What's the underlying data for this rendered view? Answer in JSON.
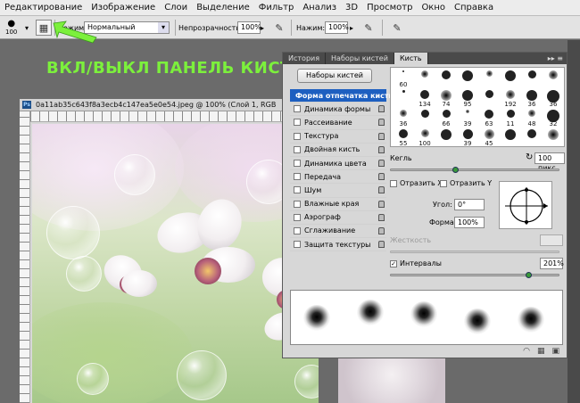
{
  "menu": [
    "Редактирование",
    "Изображение",
    "Слои",
    "Выделение",
    "Фильтр",
    "Анализ",
    "3D",
    "Просмотр",
    "Окно",
    "Справка"
  ],
  "options": {
    "brush_size": "100",
    "mode_label": "Режим:",
    "mode_value": "Нормальный",
    "opacity_label": "Непрозрачность:",
    "opacity_value": "100%",
    "flow_label": "Нажим:",
    "flow_value": "100%"
  },
  "annotation": "ВКЛ/ВЫКЛ ПАНЕЛЬ КИСТИ",
  "document": {
    "title": "0a11ab35c643f8a3ecb4c147ea5e0e54.jpeg @ 100% (Слой 1, RGB"
  },
  "panel": {
    "tabs": [
      "История",
      "Наборы кистей",
      "Кисть"
    ],
    "presets_button": "Наборы кистей",
    "options": [
      "Форма отпечатка кисти",
      "Динамика формы",
      "Рассеивание",
      "Текстура",
      "Двойная кисть",
      "Динамика цвета",
      "Передача",
      "Шум",
      "Влажные края",
      "Аэрограф",
      "Сглаживание",
      "Защита текстуры"
    ],
    "brush_tips": [
      "60",
      "",
      "",
      "",
      "",
      "",
      "",
      "",
      "",
      "134",
      "74",
      "95",
      "",
      "192",
      "36",
      "36",
      "36",
      "",
      "66",
      "39",
      "63",
      "11",
      "48",
      "32",
      "55",
      "100",
      "",
      "39",
      "45",
      "",
      "",
      "",
      "",
      "",
      "",
      ""
    ],
    "size_label": "Кегль",
    "size_value": "100 пикс",
    "flip_x": "Отразить X",
    "flip_y": "Отразить Y",
    "angle_label": "Угол:",
    "angle_value": "0°",
    "roundness_label": "Форма:",
    "roundness_value": "100%",
    "hardness_label": "Жесткость",
    "spacing_label": "Интервалы",
    "spacing_value": "201%"
  },
  "colors": {
    "annotation": "#7cf03c",
    "selected": "#1d5fc0"
  }
}
